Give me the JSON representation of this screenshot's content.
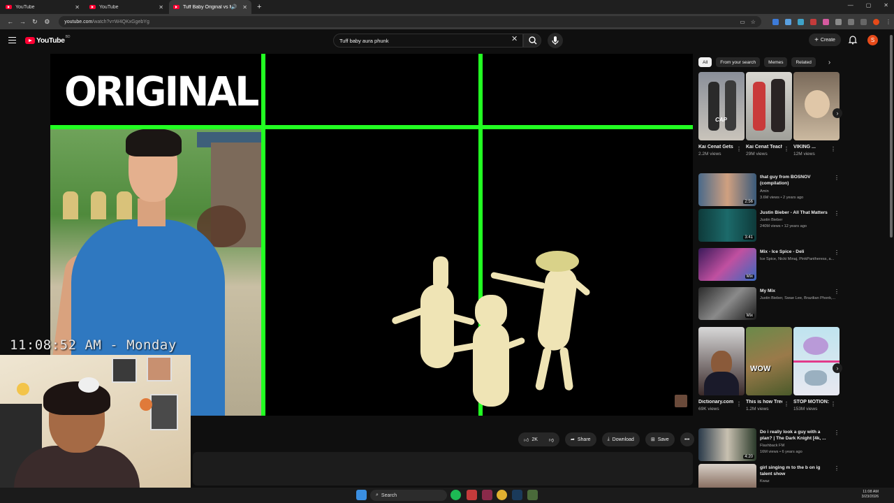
{
  "browser": {
    "tabs": [
      {
        "title": "YouTube",
        "active": false
      },
      {
        "title": "YouTube",
        "active": false
      },
      {
        "title": "Tuff Baby Original vs Meme",
        "active": true
      }
    ],
    "new_tab": "+",
    "url_host": "youtube.com",
    "url_path": "/watch?v=W4QKxGgebYg"
  },
  "header": {
    "logo_text": "YouTube",
    "country": "BD",
    "search_value": "Tuff baby aura phunk",
    "create_label": "Create",
    "avatar_letter": "S"
  },
  "video": {
    "overlay_title": "ORIGINAL"
  },
  "stream_overlay": {
    "clock": "11:08:52 AM - Monday"
  },
  "actions": {
    "like_count": "2K",
    "share_label": "Share",
    "download_label": "Download",
    "save_label": "Save",
    "more": "•••"
  },
  "sidebar": {
    "chips": [
      "All",
      "From your search",
      "Memes",
      "Related"
    ],
    "shorts_row_1": [
      {
        "title": "Kai Cenat Gets Sturdy...",
        "views": "2.2M views",
        "overlay": "CAP"
      },
      {
        "title": "Kai Cenat Teaches Ic...",
        "views": "29M views",
        "overlay": ""
      },
      {
        "title": "VIKING ...",
        "views": "12M views",
        "overlay": ""
      }
    ],
    "videos": [
      {
        "title": "that guy from BOSNOV (compilation)",
        "channel": "Amin",
        "meta": "3.6M views • 2 years ago",
        "duration": "2:56"
      },
      {
        "title": "Justin Bieber - All That Matters",
        "channel": "Justin Bieber",
        "meta": "240M views • 12 years ago",
        "duration": "3:41"
      },
      {
        "title": "Mix - Ice Spice - Deli",
        "channel": "Ice Spice, Nicki Minaj, PinkPantheress, a...",
        "meta": "",
        "duration": "Mix"
      },
      {
        "title": "My Mix",
        "channel": "Justin Bieber, Swae Lee, Brazilian Phonk,...",
        "meta": "",
        "duration": "Mix"
      }
    ],
    "shorts_row_2": [
      {
        "title": "Dictionary.com Names \"...",
        "views": "69K views",
        "overlay": ""
      },
      {
        "title": "This is how Tree Trunk...",
        "views": "1.2M views",
        "overlay": "WOW"
      },
      {
        "title": "STOP MOTION: ...",
        "views": "153M views",
        "overlay": ""
      }
    ],
    "videos_2": [
      {
        "title": "Do i really look a guy with a plan? | The Dark Knight [4k, ...",
        "channel": "Flashback FM",
        "meta": "16M views • 6 years ago",
        "duration": "4:20"
      },
      {
        "title": "girl singing m to the b on ig talent show",
        "channel": "Kwaz",
        "meta": "",
        "duration": ""
      }
    ]
  },
  "taskbar": {
    "search_placeholder": "Search",
    "time": "11:08 AM",
    "date": "3/23/2026"
  },
  "colors": {
    "accent_red": "#ff0033",
    "green_screen": "#22ff22",
    "background": "#0f0f0f"
  }
}
